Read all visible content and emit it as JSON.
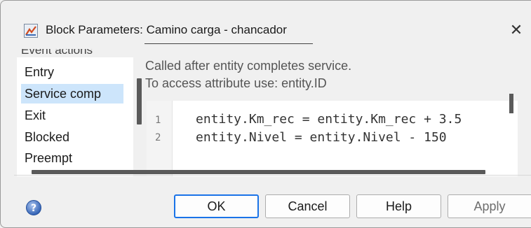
{
  "window": {
    "title": "Block Parameters: Camino carga - chancador",
    "icon": "simulink-block-icon",
    "close_glyph": "✕"
  },
  "event_actions": {
    "header_partial": "Event actions",
    "items": [
      {
        "label": "Entry",
        "selected": false
      },
      {
        "label": "Service comp",
        "selected": true
      },
      {
        "label": "Exit",
        "selected": false
      },
      {
        "label": "Blocked",
        "selected": false
      },
      {
        "label": "Preempt",
        "selected": false
      }
    ]
  },
  "description": {
    "line1": "Called after entity completes service.",
    "line2": "To access attribute use: entity.ID"
  },
  "editor": {
    "lines": [
      {
        "number": "1",
        "code": "entity.Km_rec = entity.Km_rec + 3.5"
      },
      {
        "number": "2",
        "code": "entity.Nivel = entity.Nivel - 150"
      }
    ]
  },
  "buttons": {
    "ok": "OK",
    "cancel": "Cancel",
    "help": "Help",
    "apply": "Apply",
    "help_icon": "question-icon"
  },
  "colors": {
    "selection": "#cde5fb",
    "ok_border": "#1a73e8",
    "disabled_text": "#6e6e6e"
  }
}
